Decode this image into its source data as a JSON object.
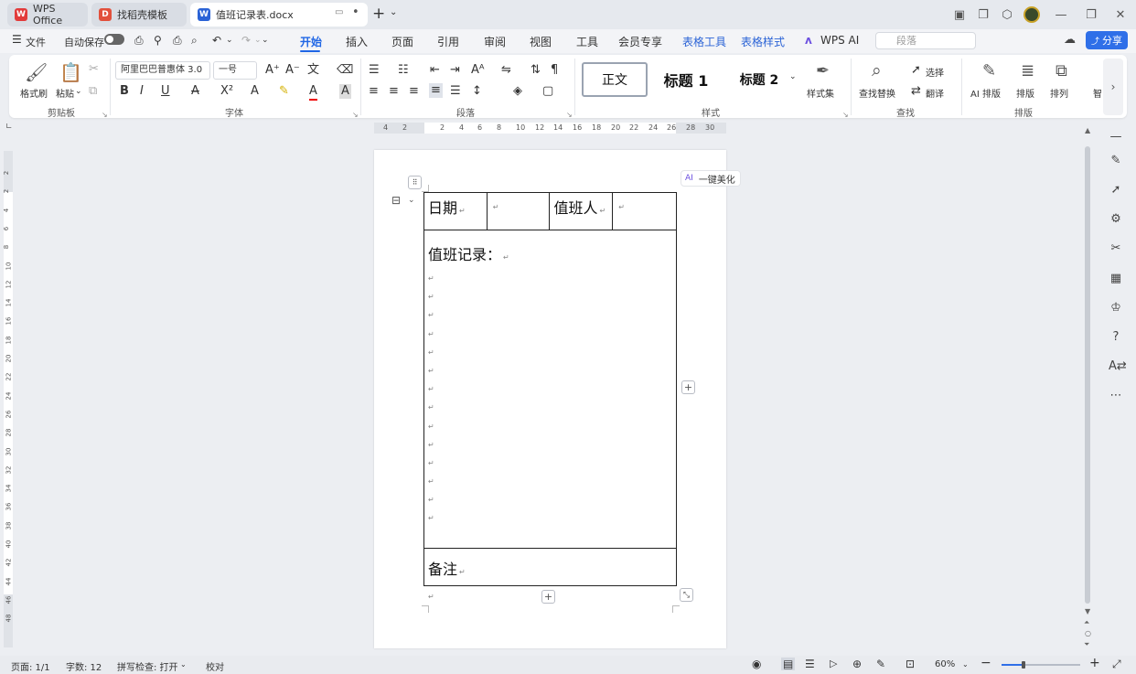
{
  "titlebar": {
    "tabs": [
      {
        "label": "WPS Office",
        "icon": "wps-logo-icon"
      },
      {
        "label": "找稻壳模板",
        "icon": "docer-icon"
      },
      {
        "label": "值班记录表.docx",
        "icon": "word-doc-icon"
      }
    ],
    "new_tab": "+"
  },
  "menubar": {
    "file": "文件",
    "autosave": "自动保存",
    "tabs": [
      "开始",
      "插入",
      "页面",
      "引用",
      "审阅",
      "视图",
      "工具",
      "会员专享"
    ],
    "context_tabs": [
      "表格工具",
      "表格样式"
    ],
    "wps_ai": "WPS AI",
    "search_placeholder": "段落",
    "share": "分享"
  },
  "ribbon": {
    "clipboard": {
      "format_painter": "格式刷",
      "paste": "粘贴",
      "group": "剪贴板"
    },
    "font": {
      "family": "阿里巴巴普惠体 3.0",
      "size": "一号",
      "group": "字体"
    },
    "paragraph": {
      "group": "段落"
    },
    "styles": {
      "normal": "正文",
      "heading1": "标题 1",
      "heading2": "标题 2",
      "style_set": "样式集",
      "group": "样式"
    },
    "find": {
      "find_replace": "查找替换",
      "select": "选择",
      "translate": "翻译",
      "group": "查找"
    },
    "layout": {
      "ai_layout": "AI 排版",
      "typeset": "排版",
      "arrange": "排列",
      "more": "智",
      "group": "排版"
    }
  },
  "ruler": {
    "h_numbers": [
      "4",
      "2",
      "2",
      "4",
      "6",
      "8",
      "10",
      "12",
      "14",
      "16",
      "18",
      "20",
      "22",
      "24",
      "26",
      "28",
      "30"
    ],
    "v_numbers": [
      "2",
      "2",
      "4",
      "6",
      "8",
      "10",
      "12",
      "14",
      "16",
      "18",
      "20",
      "22",
      "24",
      "26",
      "28",
      "30",
      "32",
      "34",
      "36",
      "38",
      "40",
      "42",
      "44",
      "46",
      "48"
    ]
  },
  "document": {
    "date_label": "日期",
    "duty_person_label": "值班人",
    "record_label": "值班记录：",
    "notes_label": "备注",
    "ai_beautify": "一键美化",
    "ai_badge": "AI"
  },
  "statusbar": {
    "page": "页面: 1/1",
    "words": "字数: 12",
    "spellcheck": "拼写检查: 打开",
    "proofread": "校对",
    "zoom": "60%"
  },
  "colors": {
    "accent": "#1f66e5",
    "share_button": "#2f6fe8",
    "wps_red": "#e23b3b"
  }
}
